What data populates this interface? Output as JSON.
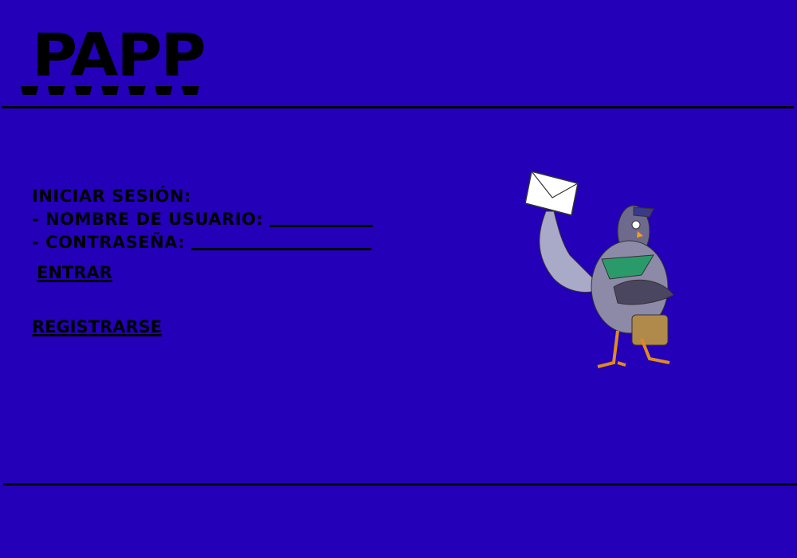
{
  "logo": {
    "text": "PAPP"
  },
  "login": {
    "heading": "Iniciar sesión:",
    "username_label": "- Nombre de usuario:",
    "username_value": "",
    "password_label": "- Contraseña:",
    "password_value": "",
    "submit_label": "Entrar"
  },
  "register_label": "Registrarse",
  "illustration": {
    "name": "postal-pigeon-with-letter"
  },
  "colors": {
    "background": "#2400b9",
    "text": "#000000"
  }
}
